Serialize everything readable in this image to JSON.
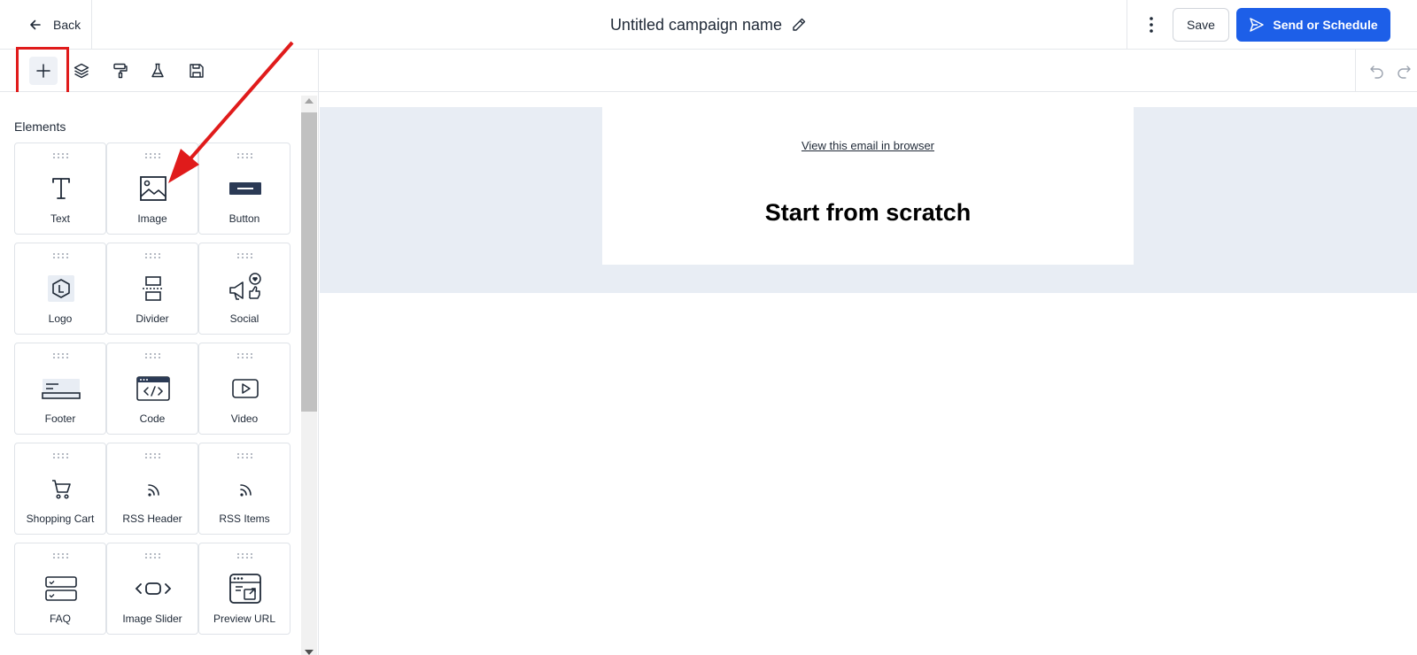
{
  "header": {
    "back_label": "Back",
    "campaign_name": "Untitled campaign name",
    "save_label": "Save",
    "send_label": "Send or Schedule",
    "accent": "#1d5fe8"
  },
  "toolbar": {
    "tools": [
      "plus-icon",
      "layers-icon",
      "paint-roller-icon",
      "flask-icon",
      "save-disk-icon"
    ],
    "active_tool": "plus-icon"
  },
  "sidebar": {
    "title": "Elements",
    "elements": [
      {
        "label": "Text",
        "icon": "text-icon"
      },
      {
        "label": "Image",
        "icon": "image-icon"
      },
      {
        "label": "Button",
        "icon": "button-icon"
      },
      {
        "label": "Logo",
        "icon": "logo-icon"
      },
      {
        "label": "Divider",
        "icon": "divider-icon"
      },
      {
        "label": "Social",
        "icon": "social-icon"
      },
      {
        "label": "Footer",
        "icon": "footer-icon"
      },
      {
        "label": "Code",
        "icon": "code-icon"
      },
      {
        "label": "Video",
        "icon": "video-icon"
      },
      {
        "label": "Shopping Cart",
        "icon": "shopping-cart-icon"
      },
      {
        "label": "RSS Header",
        "icon": "rss-icon"
      },
      {
        "label": "RSS Items",
        "icon": "rss-icon"
      },
      {
        "label": "FAQ",
        "icon": "faq-icon"
      },
      {
        "label": "Image Slider",
        "icon": "image-slider-icon"
      },
      {
        "label": "Preview URL",
        "icon": "preview-url-icon"
      }
    ]
  },
  "canvas": {
    "view_in_browser": "View this email in browser",
    "headline": "Start from scratch"
  },
  "annotation": {
    "highlight_color": "#e01b1b"
  }
}
